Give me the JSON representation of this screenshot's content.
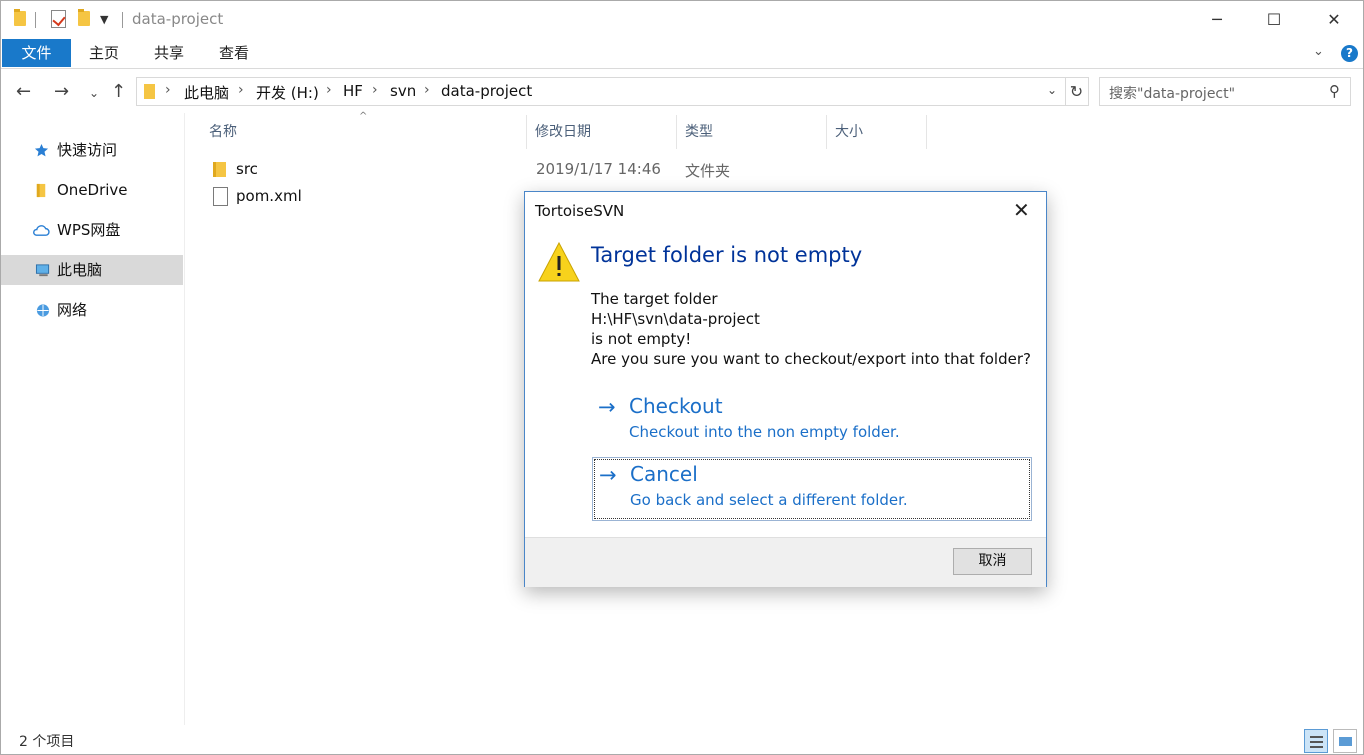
{
  "window": {
    "title": "data-project",
    "minimize_glyph": "─",
    "maximize_glyph": "☐",
    "close_glyph": "✕"
  },
  "ribbon": {
    "tabs": [
      "文件",
      "主页",
      "共享",
      "查看"
    ]
  },
  "address_bar": {
    "breadcrumb": [
      "此电脑",
      "开发 (H:)",
      "HF",
      "svn",
      "data-project"
    ]
  },
  "search": {
    "placeholder": "搜索\"data-project\""
  },
  "sidebar": {
    "items": [
      {
        "label": "快速访问",
        "icon": "star-icon"
      },
      {
        "label": "OneDrive",
        "icon": "folder-icon"
      },
      {
        "label": "WPS网盘",
        "icon": "cloud-icon"
      },
      {
        "label": "此电脑",
        "icon": "computer-icon",
        "selected": true
      },
      {
        "label": "网络",
        "icon": "network-icon"
      }
    ]
  },
  "file_list": {
    "columns": [
      "名称",
      "修改日期",
      "类型",
      "大小"
    ],
    "rows": [
      {
        "name": "src",
        "date": "2019/1/17 14:46",
        "type": "文件夹",
        "icon": "folder-icon"
      },
      {
        "name": "pom.xml",
        "date": "",
        "type": "",
        "icon": "file-icon"
      }
    ]
  },
  "status_bar": {
    "item_count": "2 个项目"
  },
  "dialog": {
    "title": "TortoiseSVN",
    "heading": "Target folder is not empty",
    "body_lines": [
      "The target folder",
      "H:\\HF\\svn\\data-project",
      "is not empty!",
      "Are you sure you want to checkout/export into that folder?"
    ],
    "commands": [
      {
        "title": "Checkout",
        "description": "Checkout into the non empty folder."
      },
      {
        "title": "Cancel",
        "description": "Go back and select a different folder."
      }
    ],
    "cancel_button": "取消"
  },
  "colors": {
    "accent": "#1979ca",
    "dialog_heading": "#003399",
    "command_link": "#1b6fc8",
    "selected_sidebar": "#d9d9d9"
  }
}
